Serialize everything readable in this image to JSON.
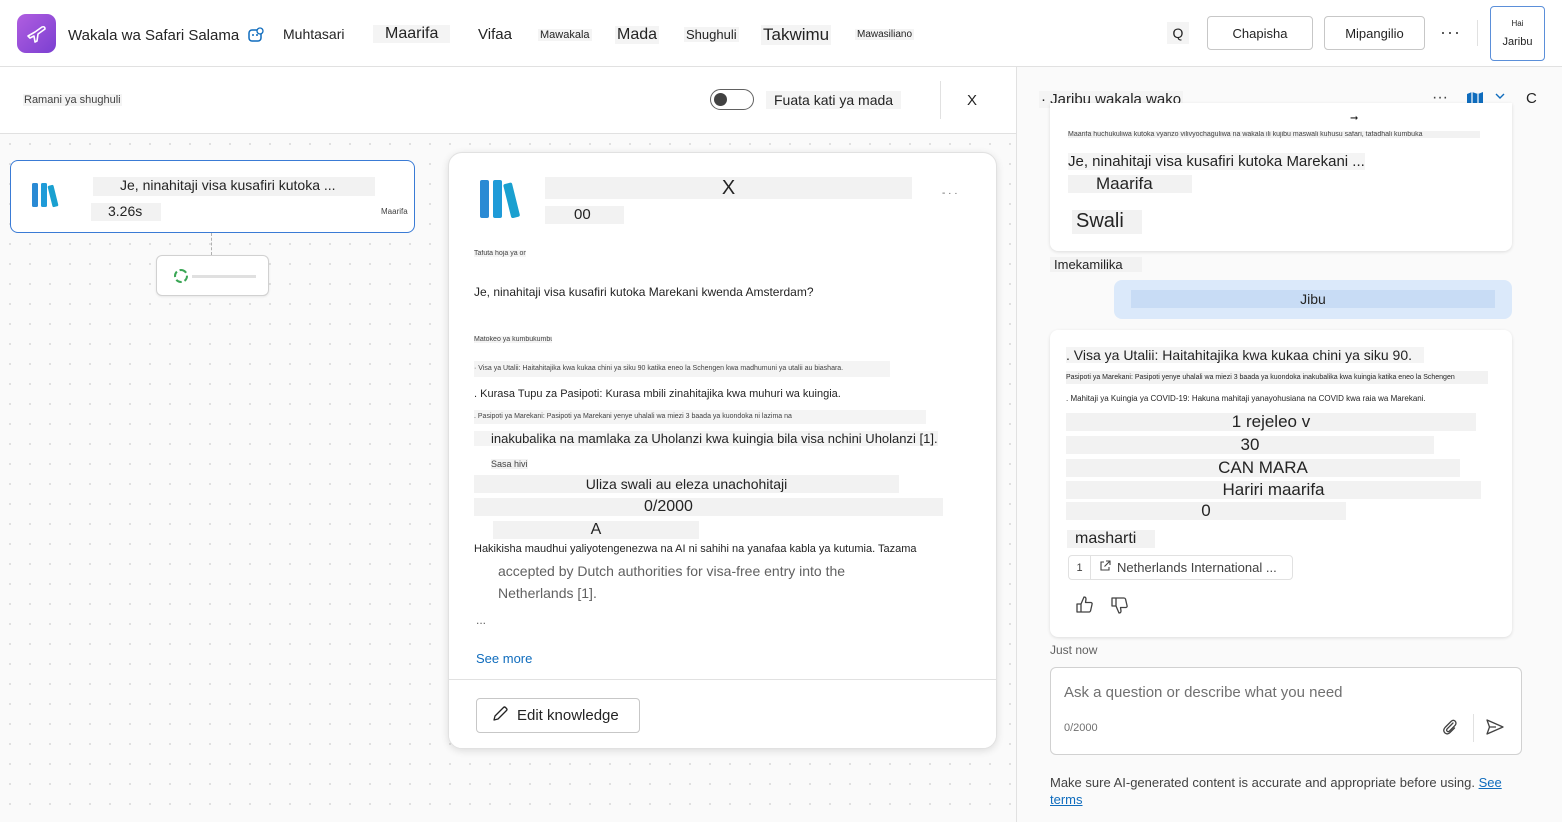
{
  "header": {
    "agent_name": "Wakala wa Safari Salama",
    "tabs": [
      "Muhtasari",
      "Maarifa",
      "Vifaa",
      "Mawakala",
      "Mada",
      "Shughuli",
      "Takwimu",
      "Mawasiliano"
    ],
    "search_label": "Q",
    "publish_label": "Chapisha",
    "settings_label": "Mipangilio",
    "more_label": "···",
    "test_top_label": "Hai",
    "test_label": "Jaribu"
  },
  "activity": {
    "map_label": "Ramani ya shughuli",
    "follow_label": "Fuata kati ya mada",
    "close_label": "X",
    "node": {
      "title": "Je, ninahitaji visa kusafiri kutoka ...",
      "time": "3.26s",
      "tag": "Maarifa"
    }
  },
  "detail": {
    "title": "X",
    "count": "00",
    "more": "- · ·",
    "input_label": "Tafuta hoja ya ombi",
    "query": "Je, ninahitaji visa kusafiri kutoka Marekani kwenda Amsterdam?",
    "output_label": "Matokeo ya kumbukumbu",
    "output_line": "· Visa ya Utalii: Haitahitajika kwa kukaa chini ya siku 90 katika eneo la Schengen kwa madhumuni ya utalii au biashara.",
    "line1": ". Kurasa Tupu za Pasipoti: Kurasa mbili zinahitajika kwa muhuri wa kuingia.",
    "line2": ". Pasipoti ya Marekani: Pasipoti ya Marekani yenye uhalali wa miezi 3 baada ya kuondoka ni lazima na",
    "line3": "inakubalika na mamlaka za Uholanzi kwa kuingia bila visa nchini Uholanzi [1].",
    "now_label": "Sasa hivi",
    "ask_placeholder": "Uliza swali au eleza unachohitaji",
    "counter": "0/2000",
    "a_label": "A",
    "disclaimer": "Hakikisha maudhui yaliyotengenezwa na AI ni sahihi na yanafaa kabla ya kutumia. Tazama",
    "gray1": "accepted by Dutch authorities for visa-free entry into the",
    "gray2": "Netherlands [1].",
    "ellipsis": "...",
    "see_more": "See more",
    "edit_label": "Edit knowledge"
  },
  "chat": {
    "title": "· Jaribu wakala wako",
    "more": "···",
    "refresh_label": "C",
    "msg1_small": "Maarifa huchukuliwa kutoka vyanzo vilivyochaguliwa na wakala ili kujibu maswali kuhusu safari, tafadhali kumbuka",
    "msg1_question": "Je, ninahitaji visa kusafiri kutoka Marekani ...",
    "msg1_tag": "Maarifa",
    "msg1_kind": "Swali",
    "completed": "Imekamilika",
    "user_bubble": "Jibu",
    "answer_line1": ". Visa ya Utalii: Haitahitajika kwa kukaa chini ya siku 90.",
    "answer_small1": "Pasipoti ya Marekani: Pasipoti yenye uhalali wa miezi 3 baada ya kuondoka inakubalika kwa kuingia katika eneo la Schengen",
    "answer_small2": ". Mahitaji ya Kuingia ya COVID-19: Hakuna mahitaji yanayohusiana na COVID kwa raia wa Marekani.",
    "bar1": "1 rejeleo v",
    "bar2": "30",
    "bar3": "CAN MARA",
    "bar4": "Hariri maarifa",
    "bar5": "0",
    "masharti": "masharti",
    "cite_num": "1",
    "cite_text": "Netherlands International ...",
    "just_now": "Just now",
    "input_placeholder": "Ask a question or describe what you need",
    "char_count": "0/2000",
    "disclaimer": "Make sure AI-generated content is accurate and appropriate before using.",
    "see_terms": "See terms"
  },
  "colors": {
    "accent": "#0f6cbd",
    "brand": "#8a4fd8",
    "node_border": "#3a7bd5",
    "user_bubble": "#dbe9fa"
  }
}
